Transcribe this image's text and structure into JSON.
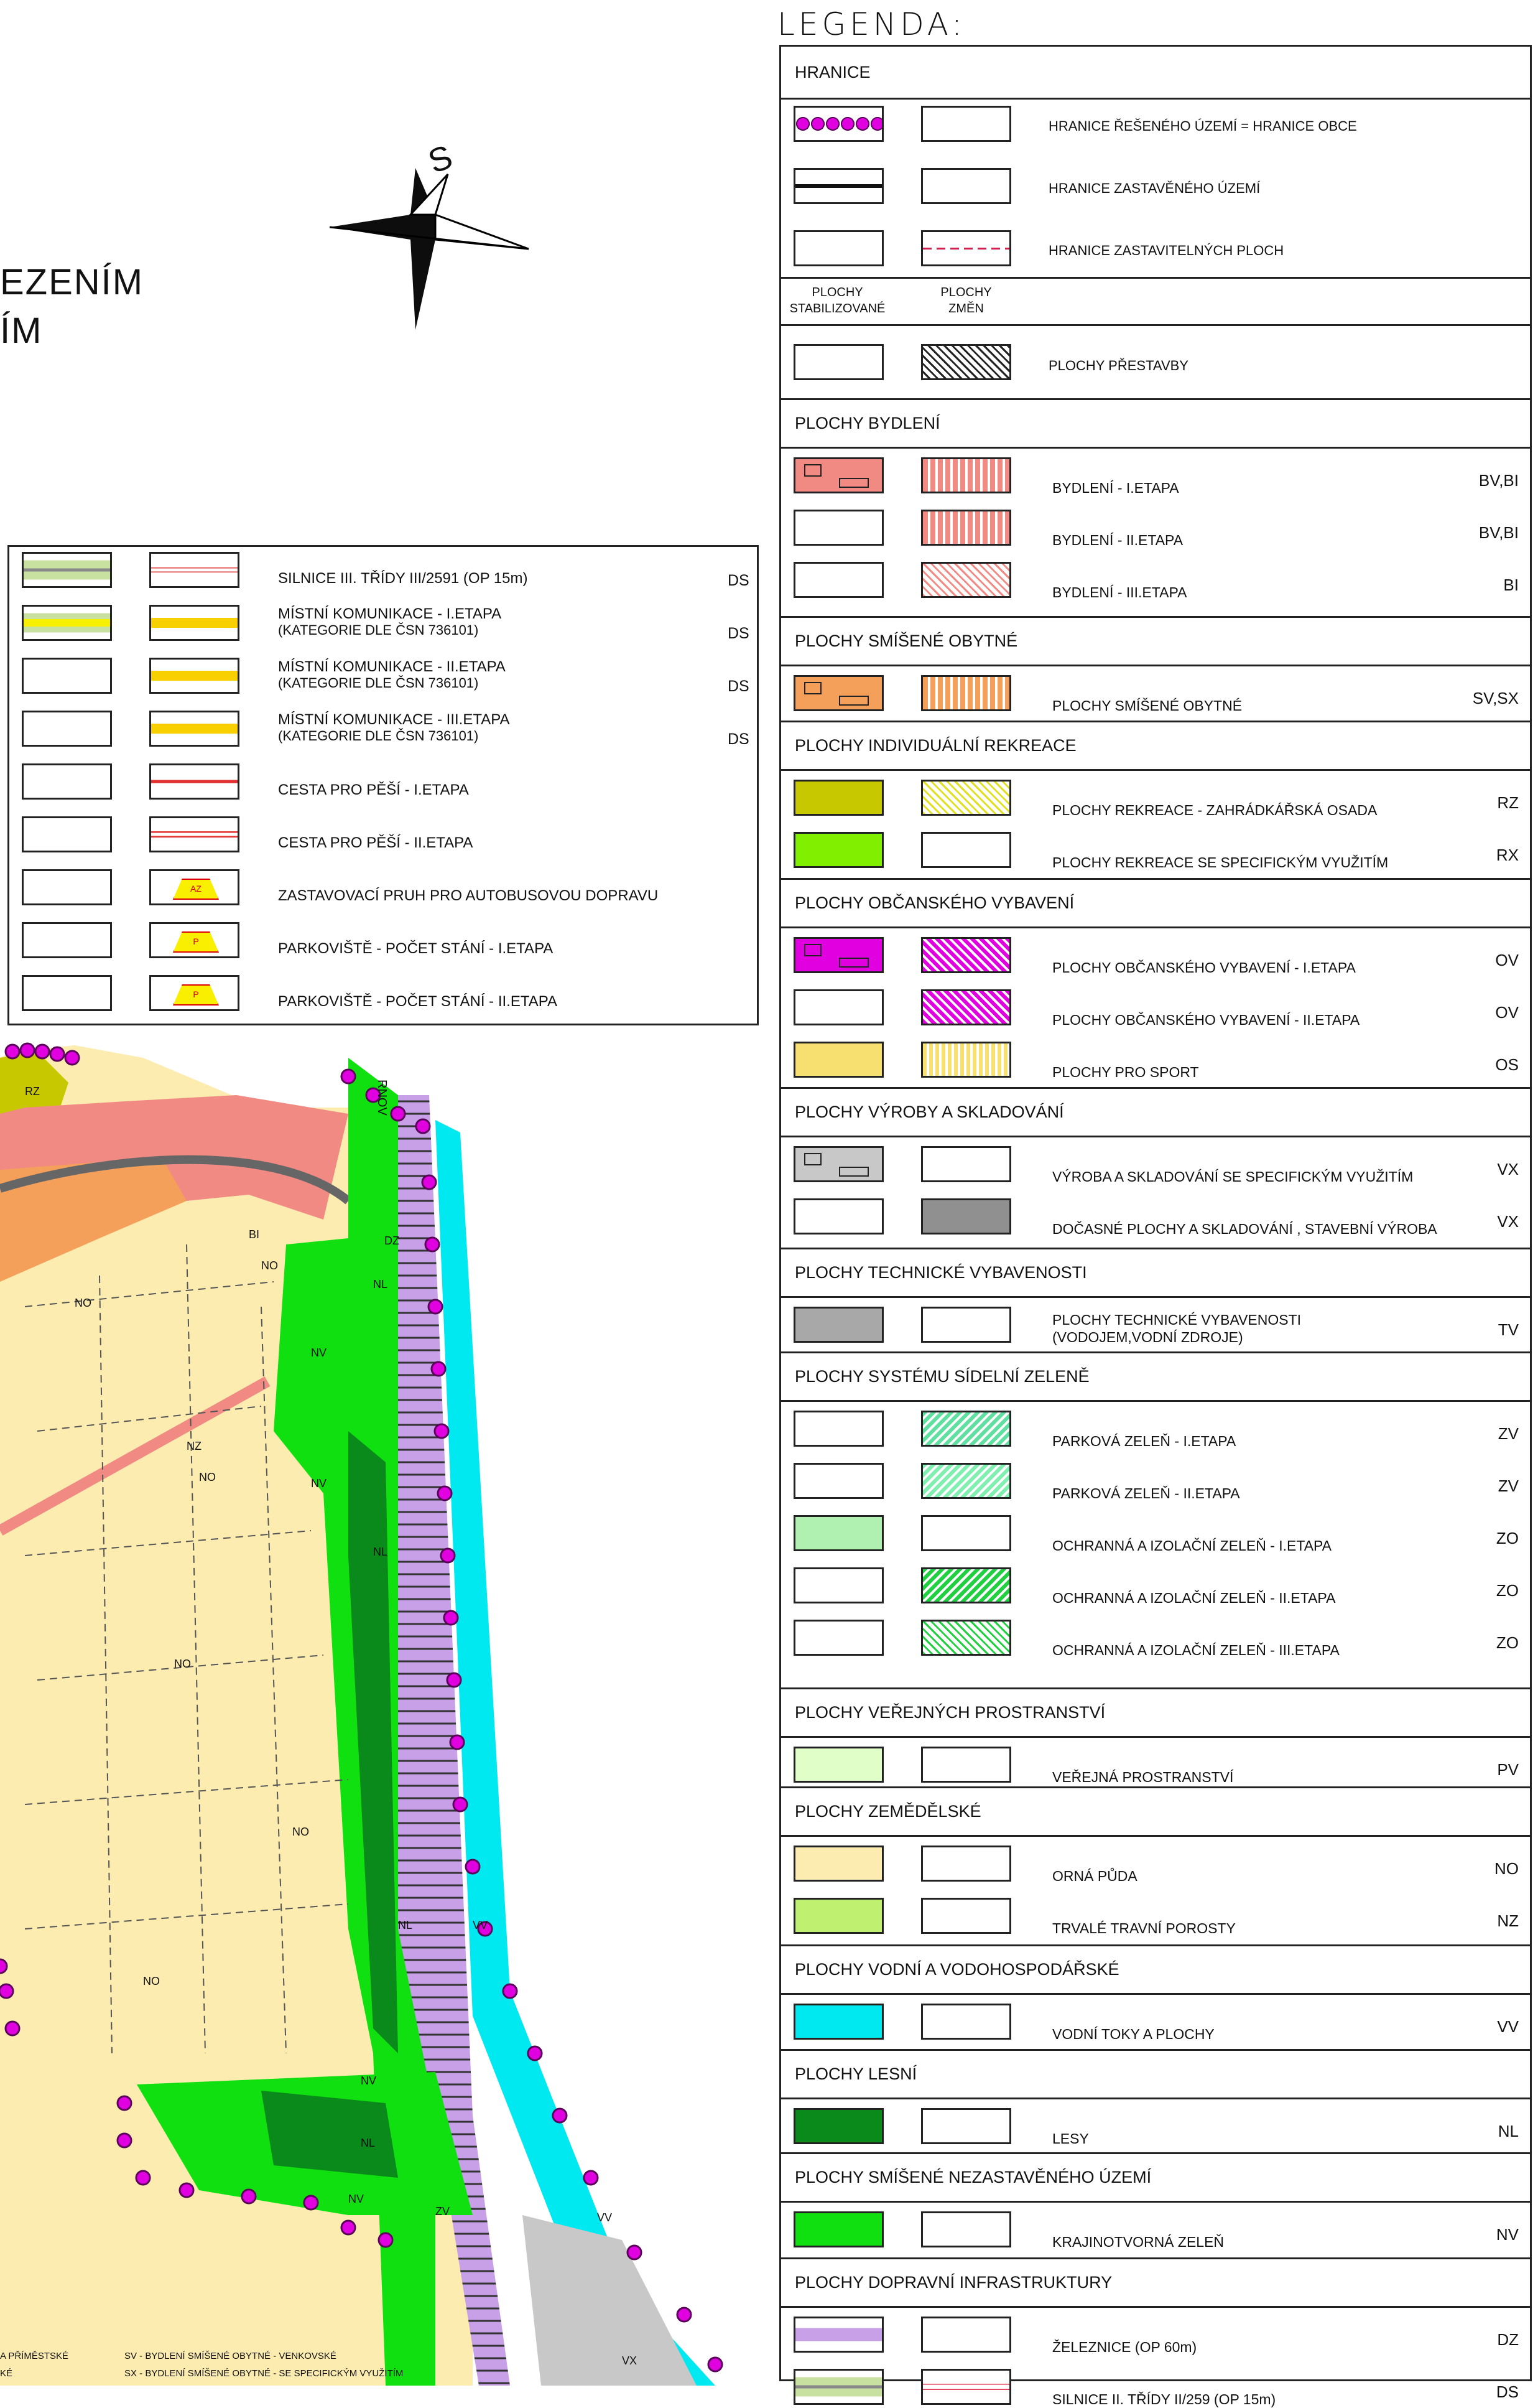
{
  "title_fragment": {
    "line1": "EZENÍM",
    "line2": "ÍM"
  },
  "compass": {
    "label": "S"
  },
  "legend_caption": "LEGENDA:",
  "map_labels": {
    "labels": [
      "NO",
      "NO",
      "NO",
      "NO",
      "NO",
      "NO",
      "BI",
      "NV",
      "NV",
      "NV",
      "NV",
      "NL",
      "NL",
      "NL",
      "NL",
      "DZ",
      "VV",
      "VV",
      "NZ",
      "RZ",
      "VX",
      "ZV"
    ],
    "road_label": "RNOV"
  },
  "roads_legend": {
    "items": [
      {
        "label": "SILNICE III. TŘÍDY III/2591  (OP 15m)",
        "code": "DS"
      },
      {
        "label": "MÍSTNÍ  KOMUNIKACE - I.ETAPA",
        "sub": "(KATEGORIE DLE ČSN 736101)",
        "code": "DS"
      },
      {
        "label": "MÍSTNÍ  KOMUNIKACE - II.ETAPA",
        "sub": "(KATEGORIE DLE ČSN 736101)",
        "code": "DS"
      },
      {
        "label": "MÍSTNÍ  KOMUNIKACE - III.ETAPA",
        "sub": "(KATEGORIE DLE ČSN 736101)",
        "code": "DS"
      },
      {
        "label": "CESTA PRO PĚŠÍ - I.ETAPA",
        "code": ""
      },
      {
        "label": "CESTA PRO PĚŠÍ - II.ETAPA",
        "code": ""
      },
      {
        "label": "ZASTAVOVACÍ  PRUH PRO AUTOBUSOVOU DOPRAVU",
        "code": "",
        "badge": "AZ"
      },
      {
        "label": "PARKOVIŠTĚ - POČET STÁNÍ  - I.ETAPA",
        "code": "",
        "badge": "P"
      },
      {
        "label": "PARKOVIŠTĚ - POČET STÁNÍ  - II.ETAPA",
        "code": "",
        "badge": "P"
      }
    ]
  },
  "legend": {
    "hranice": {
      "heading": "HRANICE",
      "items": [
        {
          "label": "HRANICE ŘEŠENÉHO ÚZEMÍ  = HRANICE OBCE"
        },
        {
          "label": "HRANICE ZASTAVĚNÉHO ÚZEMÍ"
        },
        {
          "label": "HRANICE ZASTAVITELNÝCH PLOCH"
        }
      ]
    },
    "col_headers": {
      "stab": "PLOCHY\nSTABILIZOVANÉ",
      "stab1": "PLOCHY",
      "stab2": "STABILIZOVANÉ",
      "zm1": "PLOCHY",
      "zm2": "ZMĚN"
    },
    "prestavba": {
      "label": "PLOCHY PŘESTAVBY"
    },
    "sections": [
      {
        "heading": "PLOCHY BYDLENÍ",
        "items": [
          {
            "label": "BYDLENÍ - I.ETAPA",
            "code": "BV,BI"
          },
          {
            "label": "BYDLENÍ - II.ETAPA",
            "code": "BV,BI"
          },
          {
            "label": "BYDLENÍ - III.ETAPA",
            "code": "BI"
          }
        ]
      },
      {
        "heading": "PLOCHY SMÍŠENÉ OBYTNÉ",
        "items": [
          {
            "label": "PLOCHY SMÍŠENÉ OBYTNÉ",
            "code": "SV,SX"
          }
        ]
      },
      {
        "heading": "PLOCHY INDIVIDUÁLNÍ  REKREACE",
        "items": [
          {
            "label": "PLOCHY REKREACE - ZAHRÁDKÁŘSKÁ OSADA",
            "code": "RZ"
          },
          {
            "label": "PLOCHY REKREACE SE SPECIFICKÝM VYUŽITÍM",
            "code": "RX"
          }
        ]
      },
      {
        "heading": "PLOCHY OBČANSKÉHO VYBAVENÍ",
        "items": [
          {
            "label": "PLOCHY OBČANSKÉHO VYBAVENÍ - I.ETAPA",
            "code": "OV"
          },
          {
            "label": "PLOCHY OBČANSKÉHO VYBAVENÍ - II.ETAPA",
            "code": "OV"
          },
          {
            "label": "PLOCHY PRO SPORT",
            "code": "OS"
          }
        ]
      },
      {
        "heading": "PLOCHY VÝROBY A SKLADOVÁNÍ",
        "items": [
          {
            "label": "VÝROBA A SKLADOVÁNÍ  SE SPECIFICKÝM VYUŽITÍM",
            "code": "VX"
          },
          {
            "label": "DOČASNÉ PLOCHY A SKLADOVÁNÍ , STAVEBNÍ  VÝROBA",
            "code": "VX"
          }
        ]
      },
      {
        "heading": "PLOCHY TECHNICKÉ VYBAVENOSTI",
        "items": [
          {
            "label": "PLOCHY TECHNICKÉ VYBAVENOSTI",
            "label2": "(VODOJEM,VODNÍ ZDROJE)",
            "code": "TV"
          }
        ]
      },
      {
        "heading": "PLOCHY SYSTÉMU SÍDELNÍ  ZELENĚ",
        "items": [
          {
            "label": "PARKOVÁ ZELEŇ - I.ETAPA",
            "code": "ZV"
          },
          {
            "label": "PARKOVÁ ZELEŇ - II.ETAPA",
            "code": "ZV"
          },
          {
            "label": "OCHRANNÁ A IZOLAČNÍ  ZELEŇ - I.ETAPA",
            "code": "ZO"
          },
          {
            "label": "OCHRANNÁ A IZOLAČNÍ  ZELEŇ - II.ETAPA",
            "code": "ZO"
          },
          {
            "label": "OCHRANNÁ A IZOLAČNÍ  ZELEŇ - III.ETAPA",
            "code": "ZO"
          }
        ]
      },
      {
        "heading": "PLOCHY VEŘEJNÝCH PROSTRANSTVÍ",
        "items": [
          {
            "label": "VEŘEJNÁ PROSTRANSTVÍ",
            "code": "PV"
          }
        ]
      },
      {
        "heading": "PLOCHY ZEMĚDĚLSKÉ",
        "items": [
          {
            "label": "ORNÁ PŮDA",
            "code": "NO"
          },
          {
            "label": "TRVALÉ TRAVNÍ POROSTY",
            "code": "NZ"
          }
        ]
      },
      {
        "heading": "PLOCHY VODNÍ  A VODOHOSPODÁŘSKÉ",
        "items": [
          {
            "label": "VODNÍ  TOKY A PLOCHY",
            "code": "VV"
          }
        ]
      },
      {
        "heading": "PLOCHY LESNÍ",
        "items": [
          {
            "label": "LESY",
            "code": "NL"
          }
        ]
      },
      {
        "heading": "PLOCHY SMÍŠENÉ NEZASTAVĚNÉHO ÚZEMÍ",
        "items": [
          {
            "label": "KRAJINOTVORNÁ ZELEŇ",
            "code": "NV"
          }
        ]
      },
      {
        "heading": "PLOCHY DOPRAVNÍ  INFRASTRUKTURY",
        "items": [
          {
            "label": "ŽELEZNICE (OP 60m)",
            "code": "DZ"
          },
          {
            "label": "SILNICE II. TŘÍDY II/259 (OP 15m)",
            "code": "DS"
          }
        ]
      }
    ]
  },
  "footer": {
    "f1": "A PŘÍMĚSTSKÉ",
    "f2": "KÉ",
    "f3": "SV - BYDLENÍ  SMÍŠENÉ OBYTNÉ - VENKOVSKÉ",
    "f4": "SX - BYDLENÍ  SMÍŠENÉ OBYTNÉ - SE SPECIFICKÝM VYUŽITÍM"
  },
  "colors": {
    "bydleni": "#f28a84",
    "smisene": "#f5a05a",
    "rekreace_rz": "#c8c800",
    "rekreace_rx": "#80f000",
    "obcanske": "#e000e0",
    "sport": "#f8e070",
    "vyroba": "#c8c8c8",
    "docasne": "#909090",
    "technicke": "#a8a8a8",
    "zelen_zo": "#b0f0b0",
    "verejna": "#e0ffc8",
    "orna": "#fcecb0",
    "trvale": "#c0f070",
    "vodni": "#00e8f0",
    "lesy": "#0a8a1a",
    "krajinotvorna": "#10e010",
    "zeleznice": "#c8a0e8",
    "silnice": "#c8e0a0",
    "hranice": "#e000e0"
  }
}
